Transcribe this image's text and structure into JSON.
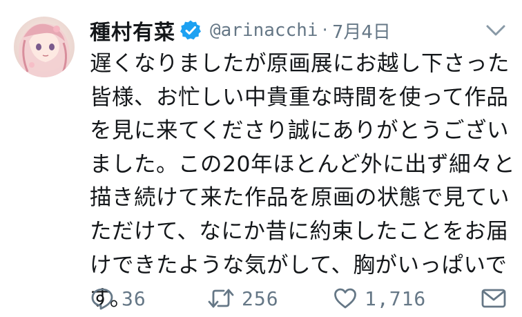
{
  "user": {
    "display_name": "種村有菜",
    "handle": "@arinacchi",
    "separator": "·",
    "date": "7月4日",
    "avatar_icon": "artwork-avatar"
  },
  "tweet": {
    "text_lines": [
      "遅くなりましたが原画展にお越し下さった",
      "皆様、お忙しい中貴重な時間を使って作品",
      "を見に来てくださり誠にありがとうござい",
      "ました。この20年ほとんど外に出ず細々と",
      "描き続けて来た作品を原画の状態で見てい",
      "ただけて、なにか昔に約束したことをお届",
      "けできたような気がして、胸がいっぱいで",
      "す。"
    ]
  },
  "actions": {
    "reply_count": "36",
    "retweet_count": "256",
    "like_count": "1,716"
  },
  "icons": {
    "verified": "verified-badge-icon",
    "caret": "chevron-down-icon",
    "reply": "reply-icon",
    "retweet": "retweet-icon",
    "like": "heart-icon",
    "dm": "envelope-icon"
  },
  "colors": {
    "text": "#14171a",
    "secondary": "#657786",
    "verified": "#1da1f2"
  }
}
